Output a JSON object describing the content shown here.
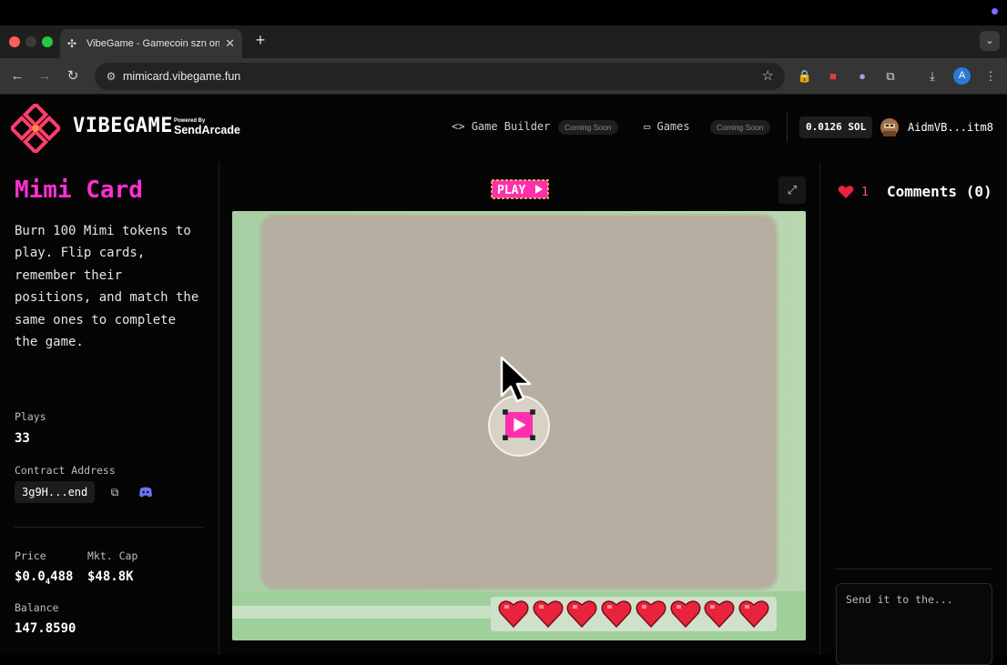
{
  "browser": {
    "tab_title": "VibeGame - Gamecoin szn on",
    "url": "mimicard.vibegame.fun",
    "profile_initial": "A"
  },
  "site": {
    "logo_text": "VIBEGAME",
    "powered_by": "Powered By",
    "sendarcade": "SendArcade",
    "nav": [
      {
        "label": "Game Builder",
        "badge": "Coming Soon",
        "icon": "code-icon"
      },
      {
        "label": "Games",
        "badge": "Coming Soon",
        "icon": "gamepad-icon"
      }
    ],
    "sol_balance": "0.0126 SOL",
    "username": "AidmVB...itm8"
  },
  "game": {
    "title": "Mimi Card",
    "description": "Burn 100 Mimi tokens to play. Flip cards, remember their positions, and match the same ones to complete the game.",
    "plays_label": "Plays",
    "plays_value": "33",
    "contract_label": "Contract Address",
    "contract_value": "3g9H...end",
    "price_label": "Price",
    "price_prefix": "$0.0",
    "price_sub": "4",
    "price_suffix": "488",
    "mktcap_label": "Mkt. Cap",
    "mktcap_value": "$48.8K",
    "balance_label": "Balance",
    "balance_value": "147.8590",
    "play_logo_text": "PLAY",
    "lives": 8
  },
  "comments": {
    "likes": "1",
    "title": "Comments (0)",
    "placeholder": "Send it to the..."
  },
  "colors": {
    "accent_pink": "#ff2fd0",
    "heart_red": "#e8243c",
    "board": "#b6aea0"
  }
}
